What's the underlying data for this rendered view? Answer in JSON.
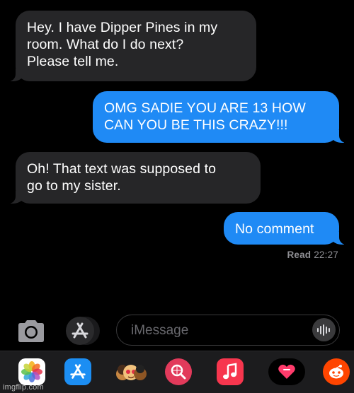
{
  "messages": [
    {
      "direction": "incoming",
      "text": "Hey. I have Dipper Pines in my\nroom. What do I do next?\nPlease tell me."
    },
    {
      "direction": "outgoing",
      "text": "OMG SADIE YOU ARE 13 HOW\nCAN YOU BE THIS CRAZY!!!"
    },
    {
      "direction": "incoming",
      "text": "Oh! That text was supposed to\ngo to my sister."
    },
    {
      "direction": "outgoing",
      "text": "No comment"
    }
  ],
  "receipt": {
    "status": "Read",
    "time": "22:27"
  },
  "composer": {
    "placeholder": "iMessage",
    "camera_icon": "camera-icon",
    "apps_icon": "app-store-icon",
    "audio_icon": "waveform-icon"
  },
  "app_drawer": [
    {
      "name": "photos-icon"
    },
    {
      "name": "app-store-icon"
    },
    {
      "name": "memoji-icon"
    },
    {
      "name": "images-search-icon"
    },
    {
      "name": "music-icon"
    },
    {
      "name": "digital-touch-icon"
    },
    {
      "name": "reddit-icon"
    }
  ],
  "watermark": "imgflip.com",
  "colors": {
    "incoming_bubble": "#262628",
    "outgoing_bubble": "#1f8af5",
    "receipt_text": "#8e8e93",
    "background": "#000000"
  }
}
